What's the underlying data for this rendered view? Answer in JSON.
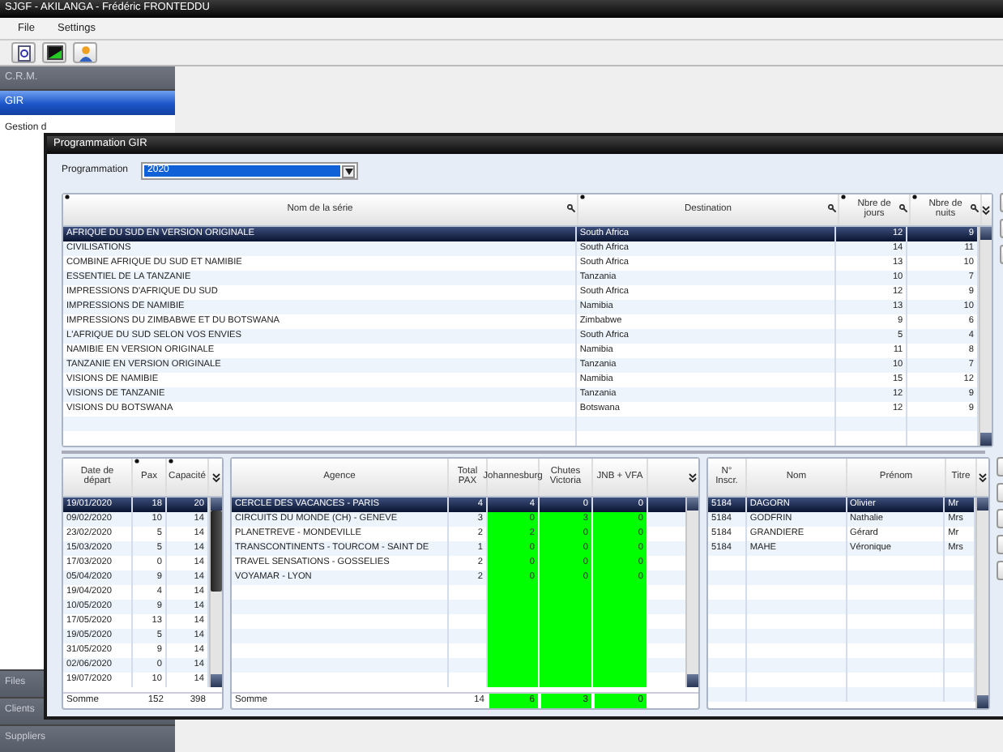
{
  "app": {
    "title": "SJGF - AKILANGA - Frédéric FRONTEDDU",
    "menu": [
      {
        "label": "File"
      },
      {
        "label": "Settings"
      }
    ]
  },
  "sidebar": {
    "sections_top": [
      {
        "label": "C.R.M.",
        "selected": false
      },
      {
        "label": "GIR",
        "selected": true
      }
    ],
    "items": [
      {
        "label": "Gestion d"
      }
    ],
    "sections_bottom": [
      {
        "label": "Files",
        "selected": false
      },
      {
        "label": "Clients",
        "selected": false
      },
      {
        "label": "Suppliers",
        "selected": false
      }
    ]
  },
  "window": {
    "title": "Programmation GIR",
    "filter": {
      "label": "Programmation",
      "value": "2020"
    },
    "series_table": {
      "columns": [
        {
          "label": "Nom de la série",
          "kind": "text",
          "pinned": true,
          "searchable": true,
          "highlighted": false
        },
        {
          "label": "Destination",
          "kind": "text",
          "pinned": true,
          "searchable": true,
          "highlighted": false
        },
        {
          "label": "Nbre de jours",
          "kind": "number",
          "pinned": true,
          "searchable": true,
          "highlighted": false
        },
        {
          "label": "Nbre de nuits",
          "kind": "number",
          "pinned": true,
          "searchable": true,
          "highlighted": false
        }
      ],
      "rows": [
        {
          "cells": [
            "AFRIQUE DU SUD EN VERSION ORIGINALE",
            "South Africa",
            "12",
            "9"
          ],
          "selected": true
        },
        {
          "cells": [
            "CIVILISATIONS",
            "South Africa",
            "14",
            "11"
          ],
          "selected": false
        },
        {
          "cells": [
            "COMBINE AFRIQUE DU SUD ET NAMIBIE",
            "South Africa",
            "13",
            "10"
          ],
          "selected": false
        },
        {
          "cells": [
            "ESSENTIEL DE LA TANZANIE",
            "Tanzania",
            "10",
            "7"
          ],
          "selected": false
        },
        {
          "cells": [
            "IMPRESSIONS D'AFRIQUE DU SUD",
            "South Africa",
            "12",
            "9"
          ],
          "selected": false
        },
        {
          "cells": [
            "IMPRESSIONS DE NAMIBIE",
            "Namibia",
            "13",
            "10"
          ],
          "selected": false
        },
        {
          "cells": [
            "IMPRESSIONS DU ZIMBABWE ET DU BOTSWANA",
            "Zimbabwe",
            "9",
            "6"
          ],
          "selected": false
        },
        {
          "cells": [
            "L'AFRIQUE DU SUD SELON VOS ENVIES",
            "South Africa",
            "5",
            "4"
          ],
          "selected": false
        },
        {
          "cells": [
            "NAMIBIE EN VERSION ORIGINALE",
            "Namibia",
            "11",
            "8"
          ],
          "selected": false
        },
        {
          "cells": [
            "TANZANIE EN VERSION ORIGINALE",
            "Tanzania",
            "10",
            "7"
          ],
          "selected": false
        },
        {
          "cells": [
            "VISIONS DE NAMIBIE",
            "Namibia",
            "15",
            "12"
          ],
          "selected": false
        },
        {
          "cells": [
            "VISIONS DE TANZANIE",
            "Tanzania",
            "12",
            "9"
          ],
          "selected": false
        },
        {
          "cells": [
            "VISIONS DU BOTSWANA",
            "Botswana",
            "12",
            "9"
          ],
          "selected": false
        }
      ]
    },
    "departures_table": {
      "columns": [
        {
          "label": "Date de départ",
          "kind": "text",
          "pinned": false,
          "searchable": false,
          "highlighted": false
        },
        {
          "label": "Pax",
          "kind": "number",
          "pinned": true,
          "searchable": false,
          "highlighted": false
        },
        {
          "label": "Capacité",
          "kind": "number",
          "pinned": true,
          "searchable": false,
          "highlighted": false
        }
      ],
      "rows": [
        {
          "cells": [
            "19/01/2020",
            "18",
            "20"
          ],
          "selected": true
        },
        {
          "cells": [
            "09/02/2020",
            "10",
            "14"
          ],
          "selected": false
        },
        {
          "cells": [
            "23/02/2020",
            "5",
            "14"
          ],
          "selected": false
        },
        {
          "cells": [
            "15/03/2020",
            "5",
            "14"
          ],
          "selected": false
        },
        {
          "cells": [
            "17/03/2020",
            "0",
            "14"
          ],
          "selected": false
        },
        {
          "cells": [
            "05/04/2020",
            "9",
            "14"
          ],
          "selected": false
        },
        {
          "cells": [
            "19/04/2020",
            "4",
            "14"
          ],
          "selected": false
        },
        {
          "cells": [
            "10/05/2020",
            "9",
            "14"
          ],
          "selected": false
        },
        {
          "cells": [
            "17/05/2020",
            "13",
            "14"
          ],
          "selected": false
        },
        {
          "cells": [
            "19/05/2020",
            "5",
            "14"
          ],
          "selected": false
        },
        {
          "cells": [
            "31/05/2020",
            "9",
            "14"
          ],
          "selected": false
        },
        {
          "cells": [
            "02/06/2020",
            "0",
            "14"
          ],
          "selected": false
        },
        {
          "cells": [
            "19/07/2020",
            "10",
            "14"
          ],
          "selected": false
        }
      ],
      "footer": [
        "Somme",
        "152",
        "398"
      ]
    },
    "agencies_table": {
      "columns": [
        {
          "label": "Agence",
          "kind": "text",
          "pinned": false,
          "searchable": false,
          "highlighted": false
        },
        {
          "label": "Total PAX",
          "kind": "number",
          "pinned": false,
          "searchable": false,
          "highlighted": false
        },
        {
          "label": "Johannesburg",
          "kind": "number",
          "pinned": false,
          "searchable": false,
          "highlighted": true
        },
        {
          "label": "Chutes Victoria",
          "kind": "number",
          "pinned": false,
          "searchable": false,
          "highlighted": true
        },
        {
          "label": "JNB + VFA",
          "kind": "number",
          "pinned": false,
          "searchable": false,
          "highlighted": true
        }
      ],
      "rows": [
        {
          "cells": [
            "CERCLE DES VACANCES - PARIS",
            "4",
            "4",
            "0",
            "0"
          ],
          "selected": true
        },
        {
          "cells": [
            "CIRCUITS DU MONDE (CH) - GENEVE",
            "3",
            "0",
            "3",
            "0"
          ],
          "selected": false
        },
        {
          "cells": [
            "PLANETREVE - MONDEVILLE",
            "2",
            "2",
            "0",
            "0"
          ],
          "selected": false
        },
        {
          "cells": [
            "TRANSCONTINENTS - TOURCOM - SAINT DE",
            "1",
            "0",
            "0",
            "0"
          ],
          "selected": false
        },
        {
          "cells": [
            "TRAVEL SENSATIONS - GOSSELIES",
            "2",
            "0",
            "0",
            "0"
          ],
          "selected": false
        },
        {
          "cells": [
            "VOYAMAR - LYON",
            "2",
            "0",
            "0",
            "0"
          ],
          "selected": false
        }
      ],
      "footer": [
        "Somme",
        "14",
        "6",
        "3",
        "0"
      ]
    },
    "passengers_table": {
      "columns": [
        {
          "label": "N° Inscr.",
          "kind": "text",
          "pinned": false,
          "searchable": false,
          "highlighted": false
        },
        {
          "label": "Nom",
          "kind": "text",
          "pinned": false,
          "searchable": false,
          "highlighted": false
        },
        {
          "label": "Prénom",
          "kind": "text",
          "pinned": false,
          "searchable": false,
          "highlighted": false
        },
        {
          "label": "Titre",
          "kind": "text",
          "pinned": false,
          "searchable": false,
          "highlighted": false
        }
      ],
      "rows": [
        {
          "cells": [
            "5184",
            "DAGORN",
            "Olivier",
            "Mr"
          ],
          "selected": true
        },
        {
          "cells": [
            "5184",
            "GODFRIN",
            "Nathalie",
            "Mrs"
          ],
          "selected": false
        },
        {
          "cells": [
            "5184",
            "GRANDIERE",
            "Gérard",
            "Mr"
          ],
          "selected": false
        },
        {
          "cells": [
            "5184",
            "MAHE",
            "Véronique",
            "Mrs"
          ],
          "selected": false
        }
      ]
    }
  }
}
